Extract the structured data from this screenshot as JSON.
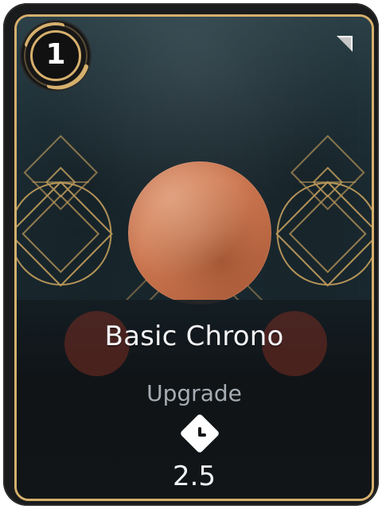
{
  "card": {
    "cost": "1",
    "title": "Basic Chrono",
    "type": "Upgrade",
    "time": "2.5",
    "icons": {
      "time": "clock-icon",
      "corner": "corner-flag-icon"
    },
    "colors": {
      "gold": "#d6b06d",
      "sun": "#cf7a52",
      "text": "#f2f3f5",
      "subtext": "#a6adb3"
    }
  }
}
